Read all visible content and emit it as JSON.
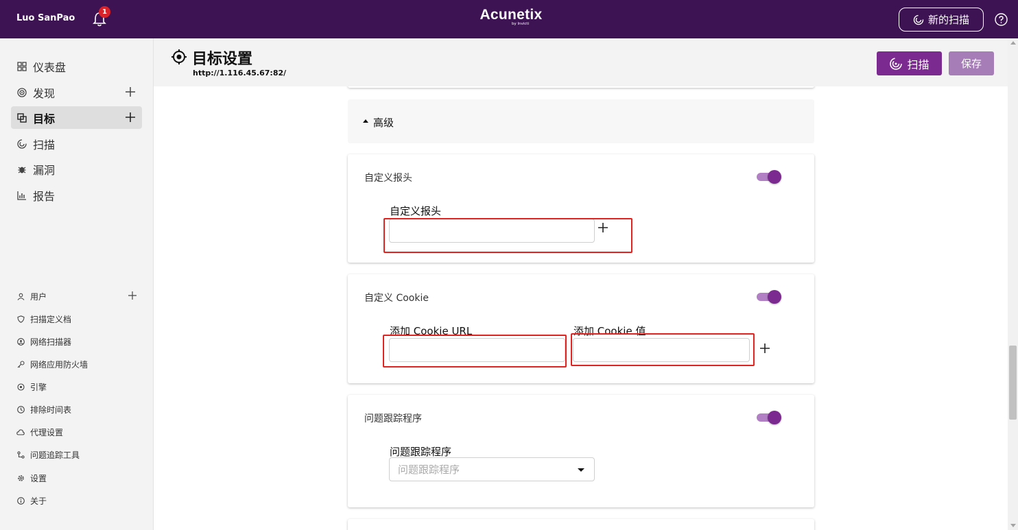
{
  "topbar": {
    "user": "Luo SanPao",
    "notification_count": "1",
    "logo": "Acunetix",
    "logo_sub": "by Invicti",
    "new_scan": "新的扫描"
  },
  "sidebar": {
    "main": [
      {
        "label": "仪表盘",
        "icon": "dashboard-icon"
      },
      {
        "label": "发现",
        "icon": "discovery-icon"
      },
      {
        "label": "目标",
        "icon": "targets-icon"
      },
      {
        "label": "扫描",
        "icon": "scans-icon"
      },
      {
        "label": "漏洞",
        "icon": "bug-icon"
      },
      {
        "label": "报告",
        "icon": "reports-icon"
      }
    ],
    "secondary": [
      {
        "label": "用户"
      },
      {
        "label": "扫描定义档"
      },
      {
        "label": "网络扫描器"
      },
      {
        "label": "网络应用防火墙"
      },
      {
        "label": "引擎"
      },
      {
        "label": "排除时间表"
      },
      {
        "label": "代理设置"
      },
      {
        "label": "问题追踪工具"
      },
      {
        "label": "设置"
      },
      {
        "label": "关于"
      }
    ]
  },
  "header": {
    "title": "目标设置",
    "url": "http://1.116.45.67:82/",
    "scan_button": "扫描",
    "save_button": "保存"
  },
  "advanced": {
    "label": "高级"
  },
  "custom_headers": {
    "title": "自定义报头",
    "enabled": true,
    "field_label": "自定义报头",
    "value": ""
  },
  "custom_cookie": {
    "title": "自定义 Cookie",
    "enabled": true,
    "url_label": "添加 Cookie URL",
    "value_label": "添加 Cookie 值",
    "url_value": "",
    "cookie_value": ""
  },
  "issue_tracker": {
    "title": "问题跟踪程序",
    "enabled": true,
    "field_label": "问题跟踪程序",
    "placeholder": "问题跟踪程序"
  },
  "colors": {
    "topbar": "#3e1353",
    "accent": "#7b2a8f",
    "highlight": "#e0231f"
  }
}
